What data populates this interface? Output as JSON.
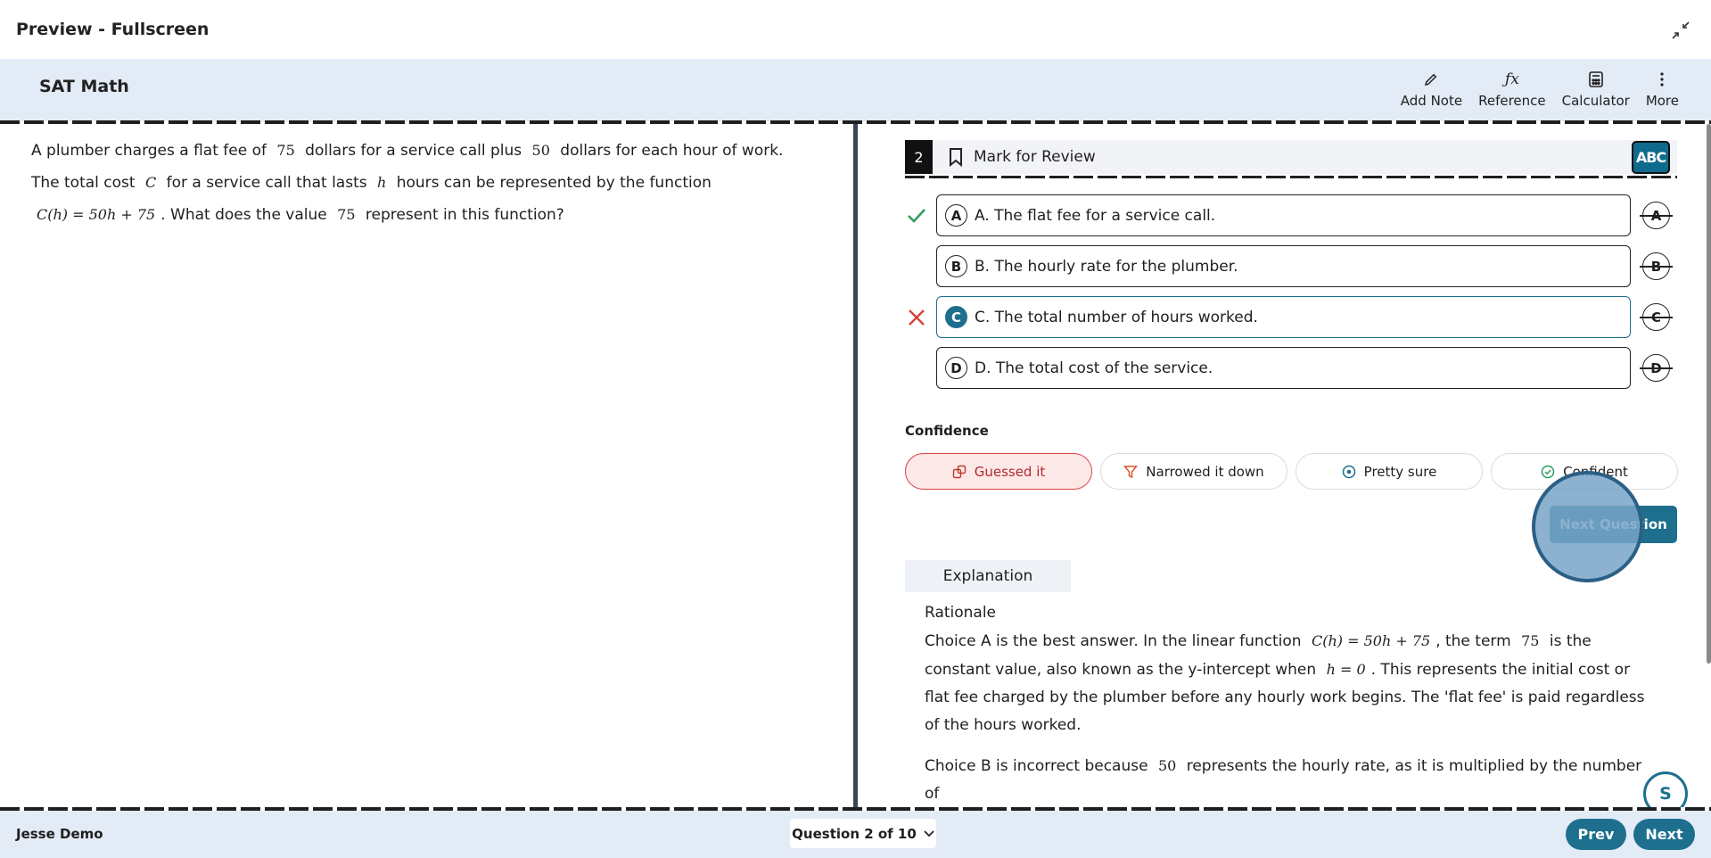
{
  "window": {
    "title": "Preview - Fullscreen"
  },
  "header": {
    "subject": "SAT Math",
    "tools": [
      {
        "label": "Add Note",
        "icon": "pencil-icon"
      },
      {
        "label": "Reference",
        "icon": "formula-icon"
      },
      {
        "label": "Calculator",
        "icon": "calculator-icon"
      },
      {
        "label": "More",
        "icon": "more-vertical-icon"
      }
    ]
  },
  "question": {
    "number": "2",
    "mark_label": "Mark for Review",
    "abc_label": "ABC",
    "stem": {
      "p1": "A plumber charges a flat fee of",
      "v1": "75",
      "p2": "dollars for a service call plus",
      "v2": "50",
      "p3": "dollars for each hour of work.",
      "p4": "The total cost",
      "v3": "C",
      "p5": "for a service call that lasts",
      "v4": "h",
      "p6": "hours can be represented by the function",
      "fn": "C(h) = 50h + 75",
      "p7": ". What does the value",
      "v5": "75",
      "p8": "represent in this function?"
    },
    "choices": [
      {
        "letter": "A",
        "text": "A. The flat fee for a service call.",
        "strike": "A"
      },
      {
        "letter": "B",
        "text": "B. The hourly rate for the plumber.",
        "strike": "B"
      },
      {
        "letter": "C",
        "text": "C. The total number of hours worked.",
        "strike": "C"
      },
      {
        "letter": "D",
        "text": "D. The total cost of the service.",
        "strike": "D"
      }
    ]
  },
  "confidence": {
    "label": "Confidence",
    "options": [
      "Guessed it",
      "Narrowed it down",
      "Pretty sure",
      "Confident"
    ]
  },
  "next_question_label": "Next Question",
  "explanation": {
    "tab": "Explanation",
    "rationale_title": "Rationale",
    "a": {
      "t1": "Choice A is the best answer. In the linear function",
      "fn": "C(h) = 50h + 75",
      "t2": ", the term",
      "v": "75",
      "t3": "is the constant value, also known as the y-intercept when",
      "h": "h = 0",
      "t4": ". This represents the initial cost or flat fee charged by the plumber before any hourly work begins. The 'flat fee' is paid regardless of the hours worked."
    },
    "b": {
      "t1": "Choice B is incorrect because",
      "v": "50",
      "t2": "represents the hourly rate, as it is multiplied by the number of"
    }
  },
  "fab_label": "S",
  "footer": {
    "user": "Jesse Demo",
    "question_select": "Question 2 of 10",
    "prev": "Prev",
    "next": "Next"
  },
  "colors": {
    "accent": "#1e6f8e",
    "header_bg": "#e3ebf7",
    "correct": "#2e9e5b",
    "wrong": "#d9413a",
    "guessed": "#b02a2a"
  }
}
